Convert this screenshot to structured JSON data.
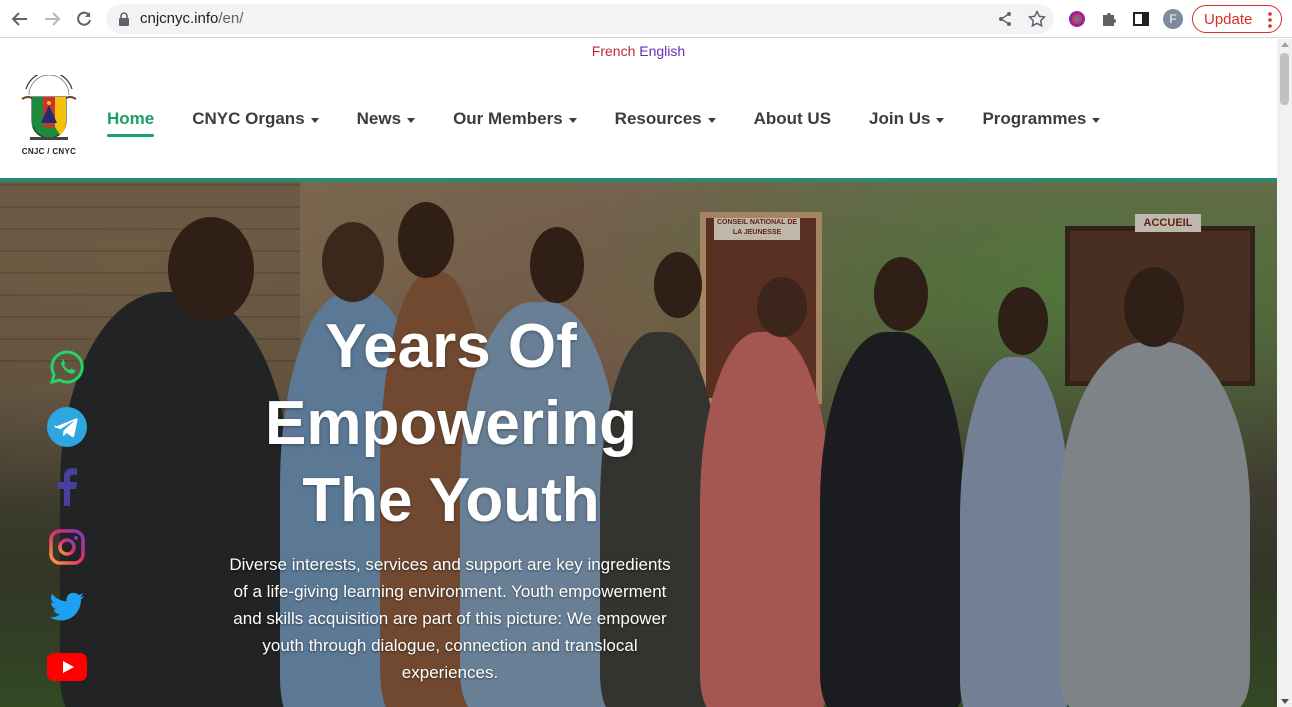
{
  "browser": {
    "url_domain": "cnjcnyc.info",
    "url_path": "/en/",
    "profile_initial": "F",
    "update_label": "Update",
    "icons": [
      "back-arrow-icon",
      "forward-arrow-icon",
      "reload-icon",
      "lock-icon",
      "share-icon",
      "bookmark-star-icon",
      "extension-color-icon",
      "puzzle-icon",
      "side-panel-icon",
      "kebab-menu-icon"
    ]
  },
  "header": {
    "lang_french": "French",
    "lang_english": "English",
    "logo_text": "CNJC / CNYC",
    "nav": [
      {
        "label": "Home",
        "active": true,
        "dropdown": false
      },
      {
        "label": "CNYC Organs",
        "dropdown": true
      },
      {
        "label": "News",
        "dropdown": true
      },
      {
        "label": "Our Members",
        "dropdown": true
      },
      {
        "label": "Resources",
        "dropdown": true
      },
      {
        "label": "About US",
        "dropdown": false
      },
      {
        "label": "Join Us",
        "dropdown": true
      },
      {
        "label": "Programmes",
        "dropdown": true
      }
    ]
  },
  "hero": {
    "title_line1": "Years Of",
    "title_line2": "Empowering",
    "title_line3": "The Youth",
    "text": "Diverse interests, services and support are key ingredients of a life-giving learning environment. Youth empowerment and skills acquisition are part of this picture: We empower youth through dialogue, connection and translocal experiences.",
    "sign_left": "CONSEIL NATIONAL DE LA JEUNESSE",
    "sign_right": "ACCUEIL"
  },
  "social": [
    "whatsapp-icon",
    "telegram-icon",
    "facebook-icon",
    "instagram-icon",
    "twitter-icon",
    "youtube-icon"
  ],
  "colors": {
    "accent_green": "#19a066",
    "teal_bar": "#2a8a79",
    "french_link": "#c0263a",
    "english_link": "#6a2bb8",
    "update_red": "#d93025"
  }
}
